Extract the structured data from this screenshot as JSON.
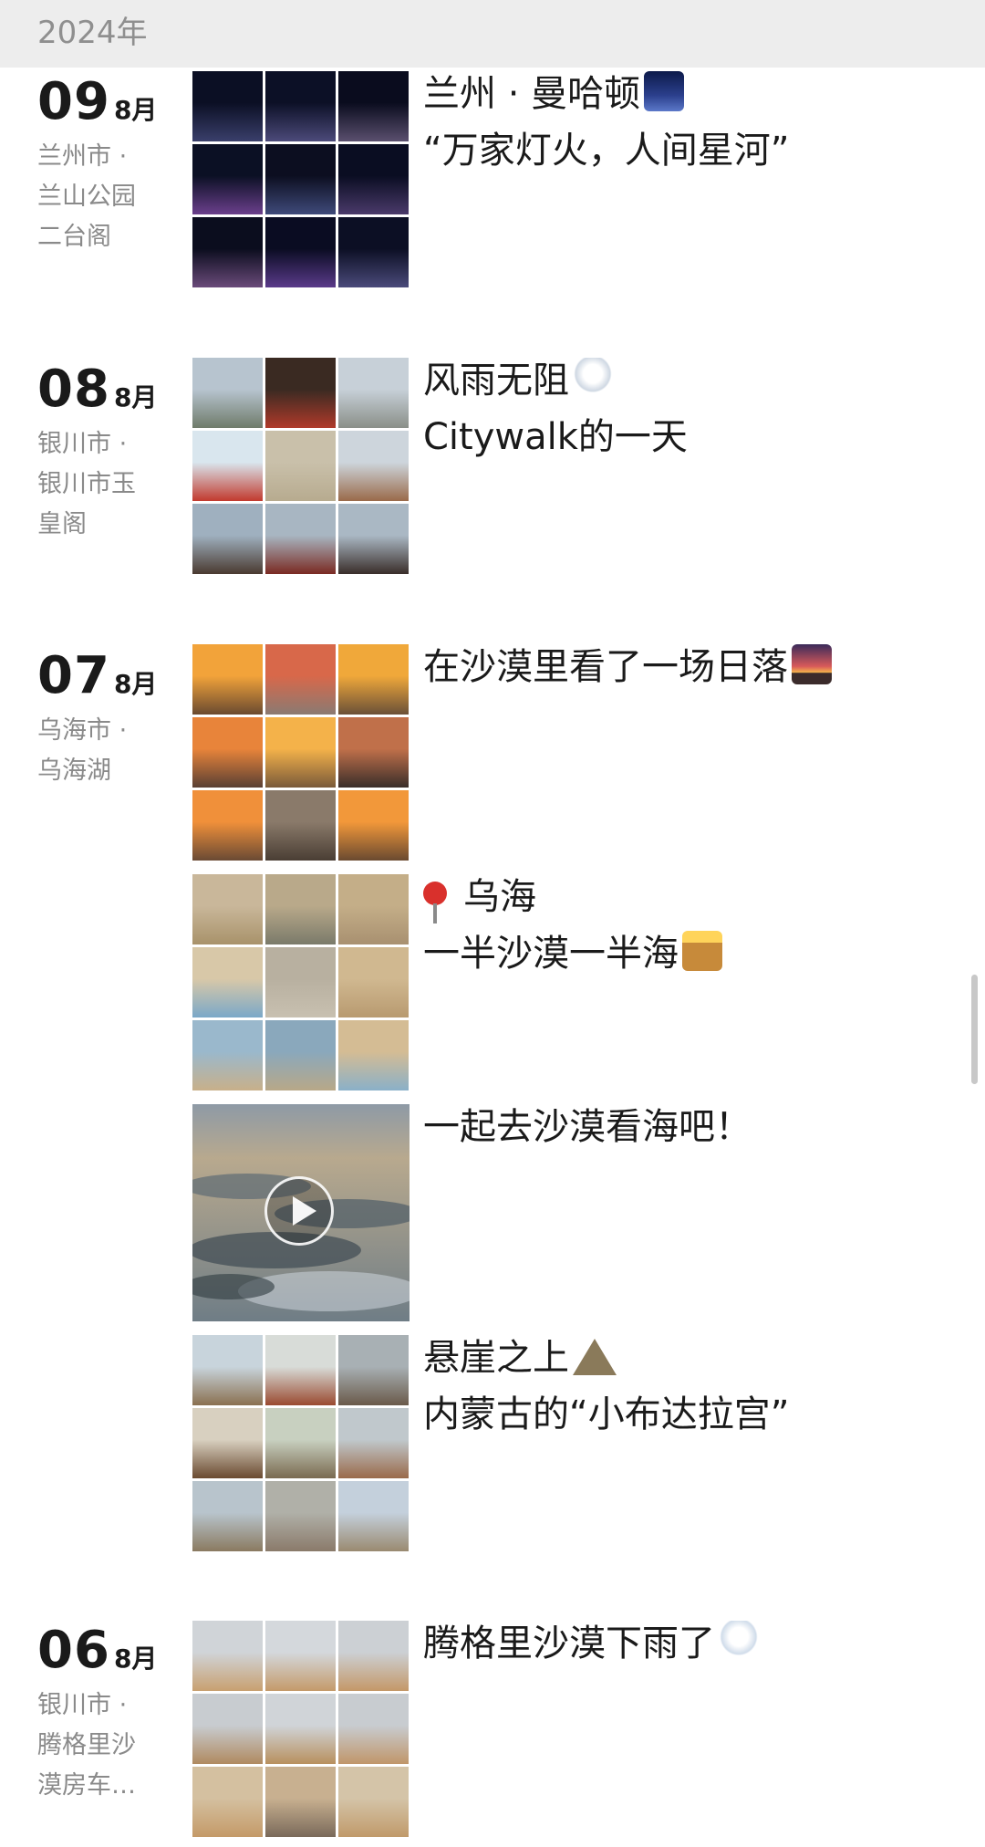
{
  "header": {
    "year": "2024年"
  },
  "entries": [
    {
      "day": "09",
      "month": "8月",
      "location": [
        "兰州市 ·",
        "兰山公园",
        "二台阁"
      ],
      "posts": [
        {
          "type": "photos",
          "line1": "兰州 · 曼哈顿",
          "line2": "“万家灯火，人间星河”",
          "emoji": "night-city-emoji",
          "palette": "night"
        }
      ]
    },
    {
      "day": "08",
      "month": "8月",
      "location": [
        "银川市 ·",
        "银川市玉",
        "皇阁"
      ],
      "posts": [
        {
          "type": "photos",
          "line1": "风雨无阻",
          "line2": "Citywalk的一天",
          "emoji": "thunderstorm-emoji",
          "palette": "city"
        }
      ]
    },
    {
      "day": "07",
      "month": "8月",
      "location": [
        "乌海市 ·",
        "乌海湖"
      ],
      "posts": [
        {
          "type": "photos",
          "line1": "在沙漠里看了一场日落",
          "line2": "",
          "emoji": "sunset-emoji",
          "palette": "sunset"
        },
        {
          "type": "photos",
          "line1": "乌海",
          "line2": "一半沙漠一半海",
          "emoji": "desert-emoji",
          "pin": true,
          "palette": "desert-lake"
        },
        {
          "type": "video",
          "line1": "一起去沙漠看海吧！",
          "line2": "",
          "palette": "lake"
        },
        {
          "type": "photos",
          "line1": "悬崖之上",
          "line2": "内蒙古的“小布达拉宫”",
          "emoji": "mountain-emoji",
          "palette": "temple"
        }
      ]
    },
    {
      "day": "06",
      "month": "8月",
      "location": [
        "银川市 ·",
        "腾格里沙",
        "漠房车…"
      ],
      "posts": [
        {
          "type": "photos",
          "line1": "腾格里沙漠下雨了",
          "line2": "",
          "emoji": "rain-cloud-emoji",
          "palette": "dunes"
        }
      ]
    }
  ],
  "colors": {
    "year_bar": "#ededed",
    "year_text": "#8f8f8f",
    "location_text": "#8a8a8a",
    "primary_text": "#1a1a1a"
  }
}
